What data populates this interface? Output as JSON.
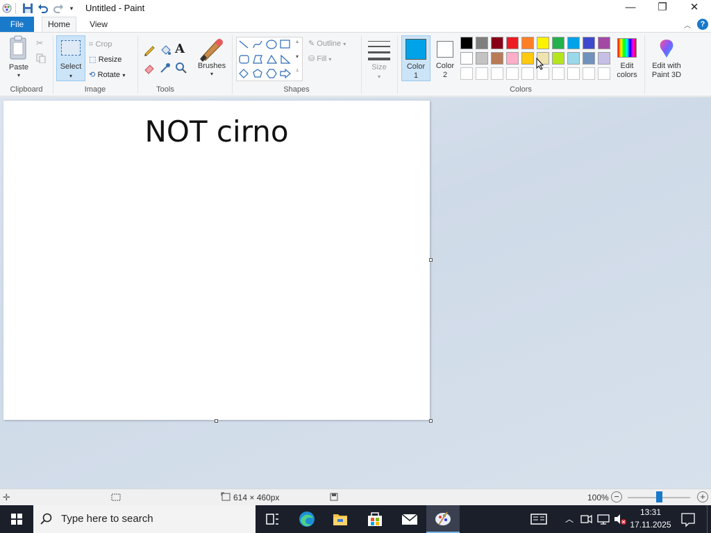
{
  "window": {
    "title": "Untitled - Paint",
    "controls": {
      "minimize": "—",
      "maximize": "❐",
      "close": "✕"
    }
  },
  "tabs": {
    "file": "File",
    "home": "Home",
    "view": "View"
  },
  "ribbon": {
    "clipboard": {
      "paste": "Paste",
      "group": "Clipboard"
    },
    "image": {
      "select": "Select",
      "crop": "Crop",
      "resize": "Resize",
      "rotate": "Rotate",
      "group": "Image"
    },
    "tools": {
      "group": "Tools"
    },
    "brushes": {
      "label": "Brushes"
    },
    "shapes": {
      "outline": "Outline",
      "fill": "Fill",
      "group": "Shapes"
    },
    "size": {
      "label": "Size"
    },
    "colors": {
      "color1": "Color\n1",
      "color1_a": "Color",
      "color1_b": "1",
      "color2_a": "Color",
      "color2_b": "2",
      "edit_a": "Edit",
      "edit_b": "colors",
      "paint3d_a": "Edit with",
      "paint3d_b": "Paint 3D",
      "group": "Colors",
      "color1_value": "#00a2e8",
      "color2_value": "#ffffff",
      "palette_row1": [
        "#000000",
        "#7f7f7f",
        "#880015",
        "#ed1c24",
        "#ff7f27",
        "#fff200",
        "#22b14c",
        "#00a2e8",
        "#3f48cc",
        "#a349a4"
      ],
      "palette_row2": [
        "#ffffff",
        "#c3c3c3",
        "#b97a57",
        "#ffaec9",
        "#ffc90e",
        "#efe4b0",
        "#b5e61d",
        "#99d9ea",
        "#7092be",
        "#c8bfe7"
      ]
    }
  },
  "canvas": {
    "text": "NOT cirno"
  },
  "status": {
    "dimensions": "614 × 460px",
    "zoom": "100%",
    "zoom_level_fraction": 0.5
  },
  "taskbar": {
    "search_placeholder": "Type here to search",
    "time": "13:31",
    "date": "17.11.2025"
  }
}
